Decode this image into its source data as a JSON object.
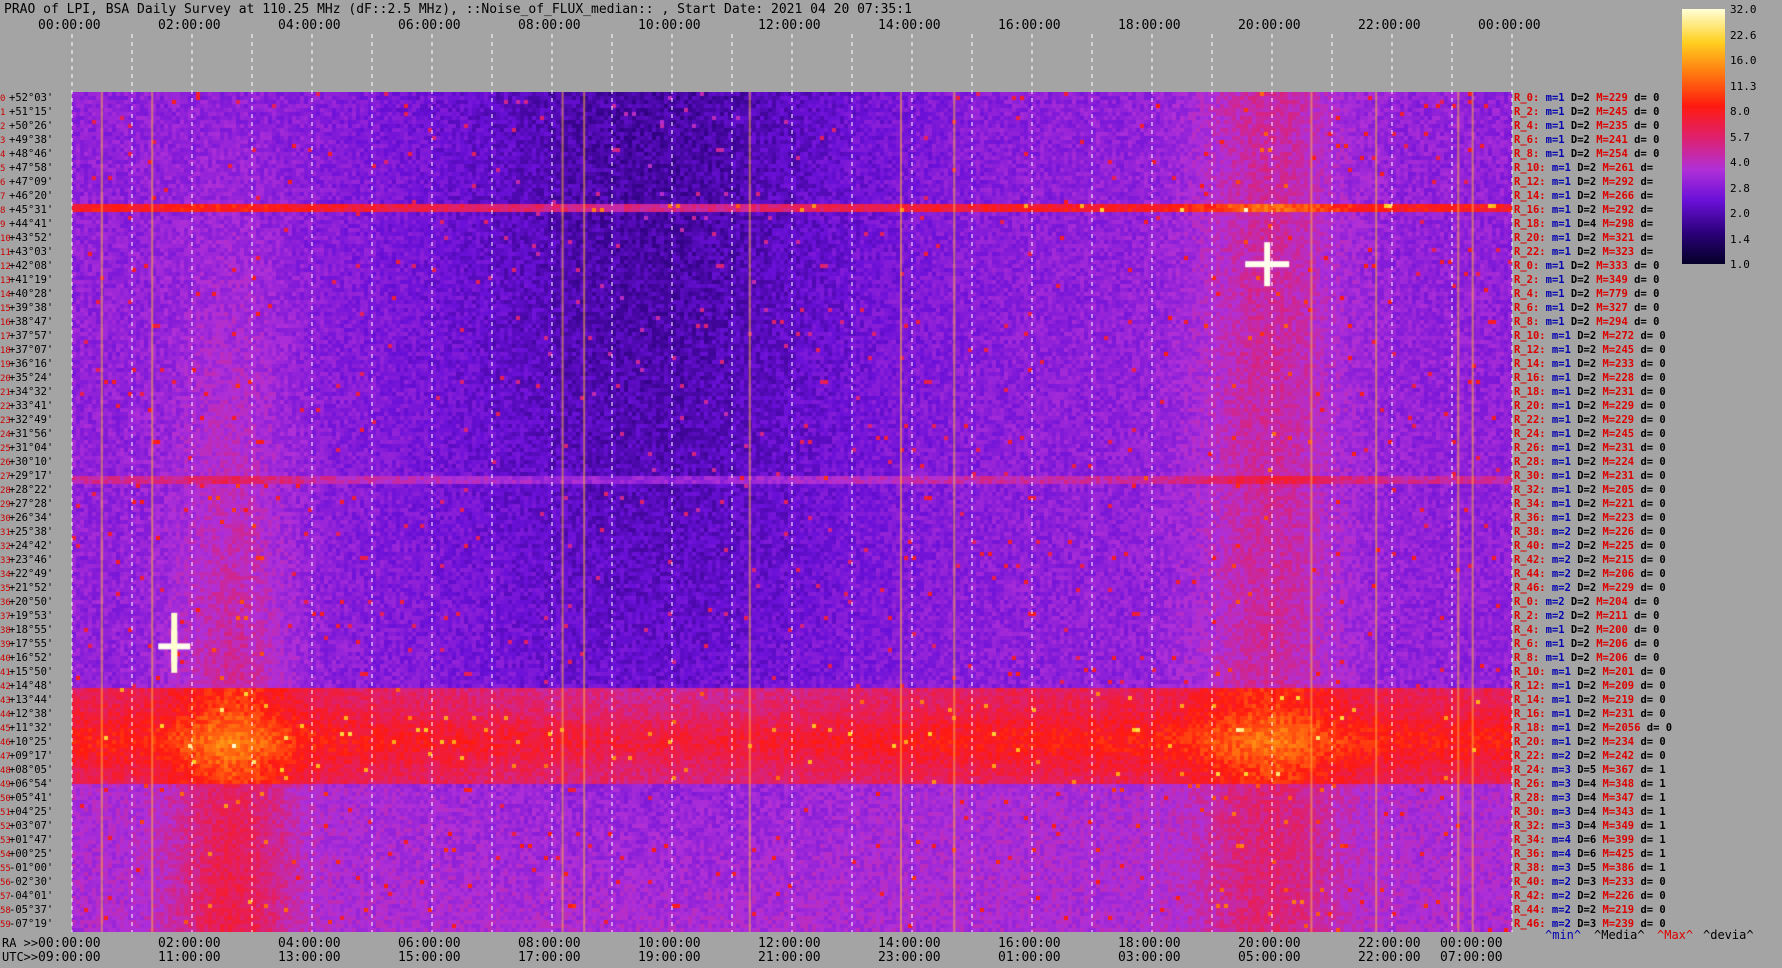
{
  "header": {
    "title": "PRAO of LPI, BSA Daily Survey at 110.25 MHz (dF::2.5 MHz), ::Noise_of_FLUX_median:: , Start Date: 2021 04 20 07:35:1"
  },
  "top_axis": [
    "00:00:00",
    "02:00:00",
    "04:00:00",
    "06:00:00",
    "08:00:00",
    "10:00:00",
    "12:00:00",
    "14:00:00",
    "16:00:00",
    "18:00:00",
    "20:00:00",
    "22:00:00",
    "00:00:00"
  ],
  "bottom_ra_axis": {
    "prefix": "RA >>",
    "ticks": [
      "00:00:00",
      "02:00:00",
      "04:00:00",
      "06:00:00",
      "08:00:00",
      "10:00:00",
      "12:00:00",
      "14:00:00",
      "16:00:00",
      "18:00:00",
      "20:00:00",
      "22:00:00",
      "00:00:00"
    ]
  },
  "bottom_utc_axis": {
    "prefix": "UTC>>",
    "ticks": [
      "09:00:00",
      "11:00:00",
      "13:00:00",
      "15:00:00",
      "17:00:00",
      "19:00:00",
      "21:00:00",
      "23:00:00",
      "01:00:00",
      "03:00:00",
      "05:00:00",
      "22:00:00",
      "07:00:00"
    ]
  },
  "colorbar": {
    "labels": [
      "32.0",
      "22.6",
      "16.0",
      "11.3",
      "8.0",
      "5.7",
      "4.0",
      "2.8",
      "2.0",
      "1.4",
      "1.0"
    ],
    "colors": [
      "#050028",
      "#2a0078",
      "#6a10d8",
      "#b030d8",
      "#e0206a",
      "#ff1a10",
      "#ff7a10",
      "#ffd020",
      "#ffffd8"
    ]
  },
  "legend": {
    "min": "^min^",
    "median": "^Media^",
    "max": "^Max^",
    "deviation": "^devia^"
  },
  "declination_labels": [
    {
      "i": "0",
      "dec": "+52°03'"
    },
    {
      "i": "1",
      "dec": "+51°15'"
    },
    {
      "i": "2",
      "dec": "+50°26'"
    },
    {
      "i": "3",
      "dec": "+49°38'"
    },
    {
      "i": "4",
      "dec": "+48°46'"
    },
    {
      "i": "5",
      "dec": "+47°58'"
    },
    {
      "i": "6",
      "dec": "+47°09'"
    },
    {
      "i": "7",
      "dec": "+46°20'"
    },
    {
      "i": "8",
      "dec": "+45°31'"
    },
    {
      "i": "9",
      "dec": "+44°41'"
    },
    {
      "i": "10",
      "dec": "+43°52'"
    },
    {
      "i": "11",
      "dec": "+43°03'"
    },
    {
      "i": "12",
      "dec": "+42°08'"
    },
    {
      "i": "13",
      "dec": "+41°19'"
    },
    {
      "i": "14",
      "dec": "+40°28'"
    },
    {
      "i": "15",
      "dec": "+39°38'"
    },
    {
      "i": "16",
      "dec": "+38°47'"
    },
    {
      "i": "17",
      "dec": "+37°57'"
    },
    {
      "i": "18",
      "dec": "+37°07'"
    },
    {
      "i": "19",
      "dec": "+36°16'"
    },
    {
      "i": "20",
      "dec": "+35°24'"
    },
    {
      "i": "21",
      "dec": "+34°32'"
    },
    {
      "i": "22",
      "dec": "+33°41'"
    },
    {
      "i": "23",
      "dec": "+32°49'"
    },
    {
      "i": "24",
      "dec": "+31°56'"
    },
    {
      "i": "25",
      "dec": "+31°04'"
    },
    {
      "i": "26",
      "dec": "+30°10'"
    },
    {
      "i": "27",
      "dec": "+29°17'"
    },
    {
      "i": "28",
      "dec": "+28°22'"
    },
    {
      "i": "29",
      "dec": "+27°28'"
    },
    {
      "i": "30",
      "dec": "+26°34'"
    },
    {
      "i": "31",
      "dec": "+25°38'"
    },
    {
      "i": "32",
      "dec": "+24°42'"
    },
    {
      "i": "33",
      "dec": "+23°46'"
    },
    {
      "i": "34",
      "dec": "+22°49'"
    },
    {
      "i": "35",
      "dec": "+21°52'"
    },
    {
      "i": "36",
      "dec": "+20°50'"
    },
    {
      "i": "37",
      "dec": "+19°53'"
    },
    {
      "i": "38",
      "dec": "+18°55'"
    },
    {
      "i": "39",
      "dec": "+17°55'"
    },
    {
      "i": "40",
      "dec": "+16°52'"
    },
    {
      "i": "41",
      "dec": "+15°50'"
    },
    {
      "i": "42",
      "dec": "+14°48'"
    },
    {
      "i": "43",
      "dec": "+13°44'"
    },
    {
      "i": "44",
      "dec": "+12°38'"
    },
    {
      "i": "45",
      "dec": "+11°32'"
    },
    {
      "i": "46",
      "dec": "+10°25'"
    },
    {
      "i": "47",
      "dec": "+09°17'"
    },
    {
      "i": "48",
      "dec": "+08°05'"
    },
    {
      "i": "49",
      "dec": "+06°54'"
    },
    {
      "i": "50",
      "dec": "+05°41'"
    },
    {
      "i": "51",
      "dec": "+04°25'"
    },
    {
      "i": "52",
      "dec": "+03°07'"
    },
    {
      "i": "53",
      "dec": "+01°47'"
    },
    {
      "i": "54",
      "dec": "+00°25'"
    },
    {
      "i": "55",
      "dec": "-01°00'"
    },
    {
      "i": "56",
      "dec": "-02°30'"
    },
    {
      "i": "57",
      "dec": "-04°01'"
    },
    {
      "i": "58",
      "dec": "-05°37'"
    },
    {
      "i": "59",
      "dec": "-07°19'"
    }
  ],
  "stats": [
    {
      "r": "R_0:",
      "m": "m=1",
      "D": "D=2",
      "M": "M=229",
      "d": "d= 0"
    },
    {
      "r": "R_2:",
      "m": "m=1",
      "D": "D=2",
      "M": "M=245",
      "d": "d= 0"
    },
    {
      "r": "R_4:",
      "m": "m=1",
      "D": "D=2",
      "M": "M=235",
      "d": "d= 0"
    },
    {
      "r": "R_6:",
      "m": "m=1",
      "D": "D=2",
      "M": "M=241",
      "d": "d= 0"
    },
    {
      "r": "R_8:",
      "m": "m=1",
      "D": "D=2",
      "M": "M=254",
      "d": "d= 0"
    },
    {
      "r": "R_10:",
      "m": "m=1",
      "D": "D=2",
      "M": "M=261",
      "d": "d="
    },
    {
      "r": "R_12:",
      "m": "m=1",
      "D": "D=2",
      "M": "M=292",
      "d": "d="
    },
    {
      "r": "R_14:",
      "m": "m=1",
      "D": "D=2",
      "M": "M=266",
      "d": "d="
    },
    {
      "r": "R_16:",
      "m": "m=1",
      "D": "D=2",
      "M": "M=292",
      "d": "d="
    },
    {
      "r": "R_18:",
      "m": "m=1",
      "D": "D=4",
      "M": "M=298",
      "d": "d="
    },
    {
      "r": "R_20:",
      "m": "m=1",
      "D": "D=2",
      "M": "M=321",
      "d": "d="
    },
    {
      "r": "R_22:",
      "m": "m=1",
      "D": "D=2",
      "M": "M=323",
      "d": "d="
    },
    {
      "r": "R_0:",
      "m": "m=1",
      "D": "D=2",
      "M": "M=333",
      "d": "d= 0"
    },
    {
      "r": "R_2:",
      "m": "m=1",
      "D": "D=2",
      "M": "M=349",
      "d": "d= 0"
    },
    {
      "r": "R_4:",
      "m": "m=1",
      "D": "D=2",
      "M": "M=779",
      "d": "d= 0"
    },
    {
      "r": "R_6:",
      "m": "m=1",
      "D": "D=2",
      "M": "M=327",
      "d": "d= 0"
    },
    {
      "r": "R_8:",
      "m": "m=1",
      "D": "D=2",
      "M": "M=294",
      "d": "d= 0"
    },
    {
      "r": "R_10:",
      "m": "m=1",
      "D": "D=2",
      "M": "M=272",
      "d": "d= 0"
    },
    {
      "r": "R_12:",
      "m": "m=1",
      "D": "D=2",
      "M": "M=245",
      "d": "d= 0"
    },
    {
      "r": "R_14:",
      "m": "m=1",
      "D": "D=2",
      "M": "M=233",
      "d": "d= 0"
    },
    {
      "r": "R_16:",
      "m": "m=1",
      "D": "D=2",
      "M": "M=228",
      "d": "d= 0"
    },
    {
      "r": "R_18:",
      "m": "m=1",
      "D": "D=2",
      "M": "M=231",
      "d": "d= 0"
    },
    {
      "r": "R_20:",
      "m": "m=1",
      "D": "D=2",
      "M": "M=229",
      "d": "d= 0"
    },
    {
      "r": "R_22:",
      "m": "m=1",
      "D": "D=2",
      "M": "M=229",
      "d": "d= 0"
    },
    {
      "r": "R_24:",
      "m": "m=1",
      "D": "D=2",
      "M": "M=245",
      "d": "d= 0"
    },
    {
      "r": "R_26:",
      "m": "m=1",
      "D": "D=2",
      "M": "M=231",
      "d": "d= 0"
    },
    {
      "r": "R_28:",
      "m": "m=1",
      "D": "D=2",
      "M": "M=224",
      "d": "d= 0"
    },
    {
      "r": "R_30:",
      "m": "m=1",
      "D": "D=2",
      "M": "M=231",
      "d": "d= 0"
    },
    {
      "r": "R_32:",
      "m": "m=1",
      "D": "D=2",
      "M": "M=205",
      "d": "d= 0"
    },
    {
      "r": "R_34:",
      "m": "m=1",
      "D": "D=2",
      "M": "M=221",
      "d": "d= 0"
    },
    {
      "r": "R_36:",
      "m": "m=1",
      "D": "D=2",
      "M": "M=223",
      "d": "d= 0"
    },
    {
      "r": "R_38:",
      "m": "m=2",
      "D": "D=2",
      "M": "M=226",
      "d": "d= 0"
    },
    {
      "r": "R_40:",
      "m": "m=2",
      "D": "D=2",
      "M": "M=225",
      "d": "d= 0"
    },
    {
      "r": "R_42:",
      "m": "m=2",
      "D": "D=2",
      "M": "M=215",
      "d": "d= 0"
    },
    {
      "r": "R_44:",
      "m": "m=2",
      "D": "D=2",
      "M": "M=206",
      "d": "d= 0"
    },
    {
      "r": "R_46:",
      "m": "m=2",
      "D": "D=2",
      "M": "M=229",
      "d": "d= 0"
    },
    {
      "r": "R_0:",
      "m": "m=2",
      "D": "D=2",
      "M": "M=204",
      "d": "d= 0"
    },
    {
      "r": "R_2:",
      "m": "m=2",
      "D": "D=2",
      "M": "M=211",
      "d": "d= 0"
    },
    {
      "r": "R_4:",
      "m": "m=1",
      "D": "D=2",
      "M": "M=200",
      "d": "d= 0"
    },
    {
      "r": "R_6:",
      "m": "m=1",
      "D": "D=2",
      "M": "M=206",
      "d": "d= 0"
    },
    {
      "r": "R_8:",
      "m": "m=1",
      "D": "D=2",
      "M": "M=206",
      "d": "d= 0"
    },
    {
      "r": "R_10:",
      "m": "m=1",
      "D": "D=2",
      "M": "M=201",
      "d": "d= 0"
    },
    {
      "r": "R_12:",
      "m": "m=1",
      "D": "D=2",
      "M": "M=209",
      "d": "d= 0"
    },
    {
      "r": "R_14:",
      "m": "m=1",
      "D": "D=2",
      "M": "M=219",
      "d": "d= 0"
    },
    {
      "r": "R_16:",
      "m": "m=1",
      "D": "D=2",
      "M": "M=231",
      "d": "d= 0"
    },
    {
      "r": "R_18:",
      "m": "m=1",
      "D": "D=2",
      "M": "M=2056",
      "d": "d= 0"
    },
    {
      "r": "R_20:",
      "m": "m=1",
      "D": "D=2",
      "M": "M=234",
      "d": "d= 0"
    },
    {
      "r": "R_22:",
      "m": "m=2",
      "D": "D=2",
      "M": "M=242",
      "d": "d= 0"
    },
    {
      "r": "R_24:",
      "m": "m=3",
      "D": "D=5",
      "M": "M=367",
      "d": "d= 1"
    },
    {
      "r": "R_26:",
      "m": "m=3",
      "D": "D=4",
      "M": "M=348",
      "d": "d= 1"
    },
    {
      "r": "R_28:",
      "m": "m=3",
      "D": "D=4",
      "M": "M=347",
      "d": "d= 1"
    },
    {
      "r": "R_30:",
      "m": "m=3",
      "D": "D=4",
      "M": "M=343",
      "d": "d= 1"
    },
    {
      "r": "R_32:",
      "m": "m=3",
      "D": "D=4",
      "M": "M=349",
      "d": "d= 1"
    },
    {
      "r": "R_34:",
      "m": "m=4",
      "D": "D=6",
      "M": "M=399",
      "d": "d= 1"
    },
    {
      "r": "R_36:",
      "m": "m=4",
      "D": "D=6",
      "M": "M=425",
      "d": "d= 1"
    },
    {
      "r": "R_38:",
      "m": "m=3",
      "D": "D=5",
      "M": "M=386",
      "d": "d= 1"
    },
    {
      "r": "R_40:",
      "m": "m=2",
      "D": "D=3",
      "M": "M=233",
      "d": "d= 0"
    },
    {
      "r": "R_42:",
      "m": "m=2",
      "D": "D=2",
      "M": "M=226",
      "d": "d= 0"
    },
    {
      "r": "R_44:",
      "m": "m=2",
      "D": "D=2",
      "M": "M=219",
      "d": "d= 0"
    },
    {
      "r": "R_46:",
      "m": "m=2",
      "D": "D=3",
      "M": "M=239",
      "d": "d= 0"
    }
  ],
  "chart_data": {
    "type": "heatmap",
    "title": "PRAO of LPI, BSA Daily Survey at 110.25 MHz (dF::2.5 MHz), ::Noise_of_FLUX_median:: , Start Date: 2021 04 20 07:35:1",
    "x_axis_top": "sidereal time 00:00:00 – 00:00:00 (RA)",
    "x_axis_bottom": "UTC",
    "y_axis": "declination +52°03' to -07°19'",
    "colorscale": "log, 1.0 – 32.0",
    "bright_features": [
      {
        "label": "point source",
        "ra": "02:00:00 approx",
        "dec": "+11°32' approx"
      },
      {
        "label": "point source",
        "ra": "19:50:00 approx",
        "dec": "+40°28' approx"
      },
      {
        "label": "horizontal band",
        "dec": "+44°41' approx"
      },
      {
        "label": "low-declination band",
        "dec": "+08°05' to -01°00'"
      }
    ]
  }
}
